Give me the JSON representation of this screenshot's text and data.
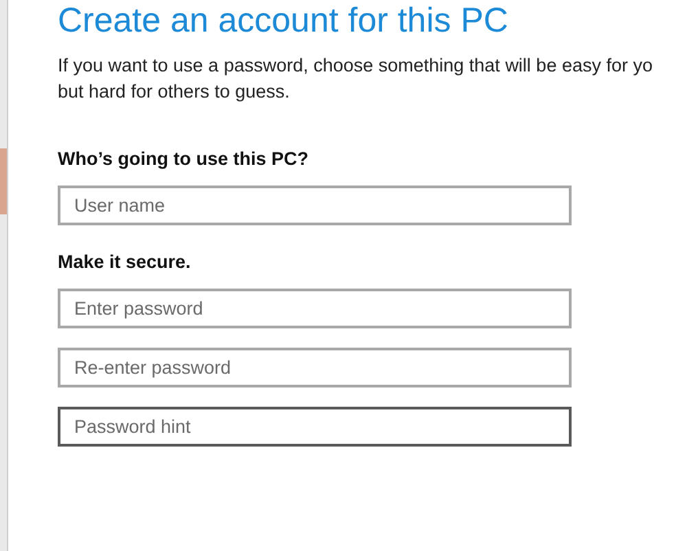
{
  "title": "Create an account for this PC",
  "intro": "If you want to use a password, choose something that will be easy for yo",
  "intro_line_2": "but hard for others to guess.",
  "sections": [
    {
      "heading": "Who’s going to use this PC?",
      "fields": [
        {
          "placeholder": "User name",
          "focused": false
        }
      ]
    },
    {
      "heading": "Make it secure.",
      "fields": [
        {
          "placeholder": "Enter password",
          "focused": false
        },
        {
          "placeholder": "Re-enter password",
          "focused": false
        },
        {
          "placeholder": "Password hint",
          "focused": true
        }
      ]
    }
  ]
}
